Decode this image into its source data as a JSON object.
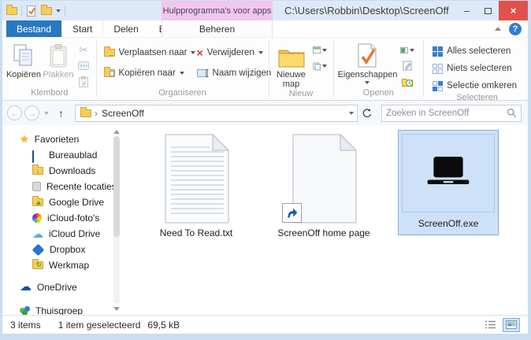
{
  "window": {
    "title": "C:\\Users\\Robbin\\Desktop\\ScreenOff",
    "contextual_badge": "Hulpprogramma's voor apps"
  },
  "icons": {
    "help": "?",
    "cut": "✂",
    "delete_x": "×",
    "close": "×",
    "minimize": "–",
    "back": "←",
    "forward": "→",
    "up": "↑",
    "star": "★",
    "breadcrumb_chevron": "›",
    "download_arrow": "↓",
    "cloud": "☁",
    "sync": "↻"
  },
  "tabs": {
    "file": "Bestand",
    "items": [
      "Start",
      "Delen",
      "Beeld"
    ],
    "contextual": "Beheren"
  },
  "ribbon": {
    "clipboard": {
      "label": "Klembord",
      "copy": "Kopiëren",
      "paste": "Plakken"
    },
    "organize": {
      "label": "Organiseren",
      "move_to": "Verplaatsen naar",
      "copy_to": "Kopiëren naar",
      "delete": "Verwijderen",
      "rename": "Naam wijzigen"
    },
    "new": {
      "label": "Nieuw",
      "new_folder": "Nieuwe map"
    },
    "open": {
      "label": "Openen",
      "properties": "Eigenschappen"
    },
    "select": {
      "label": "Selecteren",
      "select_all": "Alles selecteren",
      "select_none": "Niets selecteren",
      "invert": "Selectie omkeren"
    }
  },
  "address": {
    "location": "ScreenOff",
    "search_placeholder": "Zoeken in ScreenOff"
  },
  "sidebar": {
    "favorites": {
      "label": "Favorieten",
      "items": [
        "Bureaublad",
        "Downloads",
        "Recente locaties",
        "Google Drive",
        "iCloud-foto's",
        "iCloud Drive",
        "Dropbox",
        "Werkmap"
      ]
    },
    "onedrive": "OneDrive",
    "homegroup": "Thuisgroep"
  },
  "files": {
    "items": [
      {
        "name": "Need To Read.txt",
        "type": "text-document"
      },
      {
        "name": "ScreenOff home page",
        "type": "internet-shortcut"
      },
      {
        "name": "ScreenOff.exe",
        "type": "application",
        "selected": true
      }
    ]
  },
  "status": {
    "count": "3 items",
    "selection": "1 item geselecteerd",
    "size": "69,5 kB"
  },
  "colors": {
    "file_tab": "#2878bf",
    "contextual_badge_bg": "#efc7ef",
    "titlebar_bg": "#dde9f8",
    "close_button": "#e0514e",
    "selection_bg": "#cde1f8",
    "selection_border": "#84acdc"
  }
}
